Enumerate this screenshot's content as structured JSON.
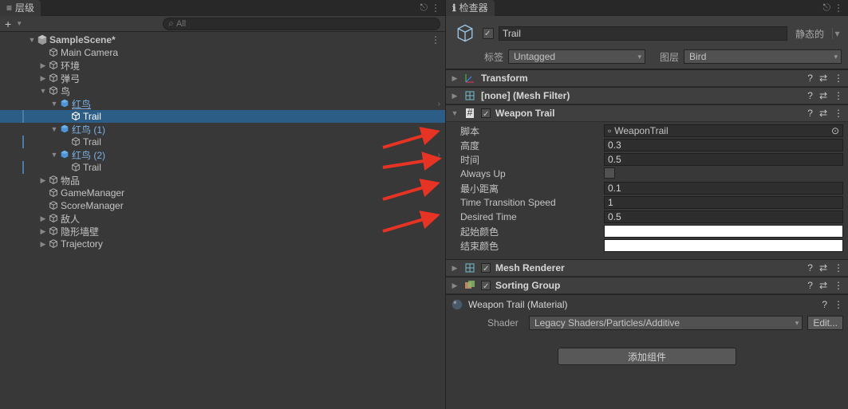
{
  "hierarchy": {
    "tab_title": "层级",
    "create_label": "+",
    "search_placeholder": "All",
    "scene": "SampleScene*",
    "items": {
      "main_camera": "Main Camera",
      "env": "环境",
      "slingshot": "弹弓",
      "bird": "鸟",
      "red_bird": "红鸟",
      "trail": "Trail",
      "red_bird_1": "红鸟 (1)",
      "red_bird_2": "红鸟 (2)",
      "items_obj": "物品",
      "game_manager": "GameManager",
      "score_manager": "ScoreManager",
      "enemies": "敌人",
      "invisible_wall": "隐形墙壁",
      "trajectory": "Trajectory"
    }
  },
  "inspector": {
    "tab_title": "检查器",
    "go_name": "Trail",
    "static_label": "静态的",
    "tag_label": "标签",
    "tag_value": "Untagged",
    "layer_label": "图层",
    "layer_value": "Bird",
    "components": {
      "transform": "Transform",
      "mesh_filter": "[none] (Mesh Filter)",
      "weapon_trail": "Weapon Trail",
      "mesh_renderer": "Mesh Renderer",
      "sorting_group": "Sorting Group"
    },
    "weapon_trail": {
      "script_label": "脚本",
      "script_value": "WeaponTrail",
      "height_label": "高度",
      "height_value": "0.3",
      "time_label": "时间",
      "time_value": "0.5",
      "always_up_label": "Always Up",
      "min_dist_label": "最小距离",
      "min_dist_value": "0.1",
      "transition_label": "Time Transition Speed",
      "transition_value": "1",
      "desired_time_label": "Desired Time",
      "desired_time_value": "0.5",
      "start_color_label": "起始颜色",
      "end_color_label": "结束颜色"
    },
    "material": {
      "name": "Weapon Trail (Material)",
      "shader_label": "Shader",
      "shader_value": "Legacy Shaders/Particles/Additive",
      "edit_label": "Edit..."
    },
    "add_component": "添加组件"
  },
  "chart_data": {
    "type": "table",
    "title": "Weapon Trail Properties",
    "rows": [
      {
        "property": "高度",
        "value": 0.3
      },
      {
        "property": "时间",
        "value": 0.5
      },
      {
        "property": "Always Up",
        "value": false
      },
      {
        "property": "最小距离",
        "value": 0.1
      },
      {
        "property": "Time Transition Speed",
        "value": 1
      },
      {
        "property": "Desired Time",
        "value": 0.5
      }
    ]
  }
}
